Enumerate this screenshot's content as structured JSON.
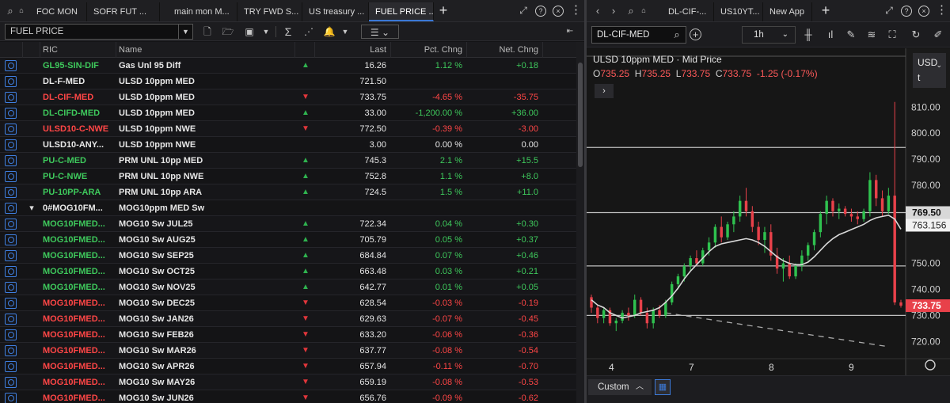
{
  "window_tabs": {
    "left": [
      {
        "label": "FOC MON",
        "active": false
      },
      {
        "label": "SOFR FUT ...",
        "active": false
      },
      {
        "label": "main mon M...",
        "active": false
      },
      {
        "label": "TRY FWD S...",
        "active": false
      },
      {
        "label": "US treasury ...",
        "active": false
      },
      {
        "label": "FUEL PRICE ...",
        "active": true
      }
    ],
    "right": [
      {
        "label": "DL-CIF-...",
        "active": false
      },
      {
        "label": "US10YT...",
        "active": false
      },
      {
        "label": "New App",
        "active": false
      }
    ]
  },
  "quote_list": {
    "search_value": "FUEL PRICE",
    "columns": {
      "ric": "RIC",
      "name": "Name",
      "last": "Last",
      "pct": "Pct. Chng",
      "net": "Net. Chng"
    },
    "rows": [
      {
        "ric": "GL95-SIN-DIF",
        "name": "Gas Unl 95 Diff",
        "dir": "up",
        "last": "16.26",
        "pct": "1.12 %",
        "net": "+0.18",
        "ric_color": "green"
      },
      {
        "ric": "DL-F-MED",
        "name": "ULSD 10ppm MED",
        "dir": "",
        "last": "721.50",
        "pct": "",
        "net": "",
        "ric_color": "white"
      },
      {
        "ric": "DL-CIF-MED",
        "name": "ULSD 10ppm MED",
        "dir": "down",
        "last": "733.75",
        "pct": "-4.65 %",
        "net": "-35.75",
        "ric_color": "red"
      },
      {
        "ric": "DL-CIFD-MED",
        "name": "ULSD 10ppm MED",
        "dir": "up",
        "last": "33.00",
        "pct": "-1,200.00 %",
        "net": "+36.00",
        "ric_color": "green"
      },
      {
        "ric": "ULSD10-C-NWE",
        "name": "ULSD 10ppm NWE",
        "dir": "down",
        "last": "772.50",
        "pct": "-0.39 %",
        "net": "-3.00",
        "ric_color": "red"
      },
      {
        "ric": "ULSD10-ANY...",
        "name": "ULSD 10ppm NWE",
        "dir": "",
        "last": "3.00",
        "pct": "0.00 %",
        "net": "0.00",
        "ric_color": "white"
      },
      {
        "ric": "PU-C-MED",
        "name": "PRM UNL 10pp MED",
        "dir": "up",
        "last": "745.3",
        "pct": "2.1 %",
        "net": "+15.5",
        "ric_color": "green"
      },
      {
        "ric": "PU-C-NWE",
        "name": "PRM UNL 10pp NWE",
        "dir": "up",
        "last": "752.8",
        "pct": "1.1 %",
        "net": "+8.0",
        "ric_color": "green"
      },
      {
        "ric": "PU-10PP-ARA",
        "name": "PRM UNL 10pp ARA",
        "dir": "up",
        "last": "724.5",
        "pct": "1.5 %",
        "net": "+11.0",
        "ric_color": "green"
      },
      {
        "ric": "0#MOG10FM...",
        "name": "MOG10ppm MED Sw",
        "dir": "",
        "last": "",
        "pct": "",
        "net": "",
        "ric_color": "white",
        "chain": true
      },
      {
        "ric": "MOG10FMED...",
        "name": "MOG10 Sw JUL25",
        "dir": "up",
        "last": "722.34",
        "pct": "0.04 %",
        "net": "+0.30",
        "ric_color": "green"
      },
      {
        "ric": "MOG10FMED...",
        "name": "MOG10 Sw AUG25",
        "dir": "up",
        "last": "705.79",
        "pct": "0.05 %",
        "net": "+0.37",
        "ric_color": "green"
      },
      {
        "ric": "MOG10FMED...",
        "name": "MOG10 Sw SEP25",
        "dir": "up",
        "last": "684.84",
        "pct": "0.07 %",
        "net": "+0.46",
        "ric_color": "green"
      },
      {
        "ric": "MOG10FMED...",
        "name": "MOG10 Sw OCT25",
        "dir": "up",
        "last": "663.48",
        "pct": "0.03 %",
        "net": "+0.21",
        "ric_color": "green"
      },
      {
        "ric": "MOG10FMED...",
        "name": "MOG10 Sw NOV25",
        "dir": "up",
        "last": "642.77",
        "pct": "0.01 %",
        "net": "+0.05",
        "ric_color": "green"
      },
      {
        "ric": "MOG10FMED...",
        "name": "MOG10 Sw DEC25",
        "dir": "down",
        "last": "628.54",
        "pct": "-0.03 %",
        "net": "-0.19",
        "ric_color": "red"
      },
      {
        "ric": "MOG10FMED...",
        "name": "MOG10 Sw JAN26",
        "dir": "down",
        "last": "629.63",
        "pct": "-0.07 %",
        "net": "-0.45",
        "ric_color": "red"
      },
      {
        "ric": "MOG10FMED...",
        "name": "MOG10 Sw FEB26",
        "dir": "down",
        "last": "633.20",
        "pct": "-0.06 %",
        "net": "-0.36",
        "ric_color": "red"
      },
      {
        "ric": "MOG10FMED...",
        "name": "MOG10 Sw MAR26",
        "dir": "down",
        "last": "637.77",
        "pct": "-0.08 %",
        "net": "-0.54",
        "ric_color": "red"
      },
      {
        "ric": "MOG10FMED...",
        "name": "MOG10 Sw APR26",
        "dir": "down",
        "last": "657.94",
        "pct": "-0.11 %",
        "net": "-0.70",
        "ric_color": "red"
      },
      {
        "ric": "MOG10FMED...",
        "name": "MOG10 Sw MAY26",
        "dir": "down",
        "last": "659.19",
        "pct": "-0.08 %",
        "net": "-0.53",
        "ric_color": "red"
      },
      {
        "ric": "MOG10FMED...",
        "name": "MOG10 Sw JUN26",
        "dir": "down",
        "last": "656.76",
        "pct": "-0.09 %",
        "net": "-0.62",
        "ric_color": "red"
      }
    ]
  },
  "chart_panel": {
    "symbol_value": "DL-CIF-MED",
    "interval": "1h",
    "currency_line1": "USD",
    "currency_line2": "t",
    "range_label": "Custom",
    "colors": {
      "up": "#2fc24f",
      "down": "#e8414a",
      "ma": "#d8d8d8",
      "price_tag": "#e8414a"
    }
  },
  "chart_data": {
    "type": "candlestick",
    "title": "ULSD 10ppm MED · Mid Price",
    "ohlc_labels": {
      "open": "735.25",
      "high": "735.25",
      "low": "733.75",
      "close": "733.75",
      "change": "-1.25 (-0.17%)"
    },
    "ylim": [
      714,
      818
    ],
    "yticks": [
      "810.00",
      "800.00",
      "790.00",
      "780.00",
      "750.00",
      "740.00",
      "730.00",
      "720.00"
    ],
    "xticks": [
      "4",
      "7",
      "8",
      "9"
    ],
    "horizontal_levels": [
      794.5,
      769.5,
      749,
      730
    ],
    "highlight_level": {
      "value": 769.5,
      "label": "769.50"
    },
    "ma_last_label": "763.156",
    "last_price_label": "733.75",
    "candles": [
      [
        737,
        738,
        731,
        733
      ],
      [
        733,
        734,
        727,
        729
      ],
      [
        729,
        733,
        727,
        732
      ],
      [
        732,
        733,
        726,
        727
      ],
      [
        727,
        729,
        724,
        728
      ],
      [
        728,
        732,
        727,
        731
      ],
      [
        731,
        733,
        728,
        730
      ],
      [
        730,
        738,
        729,
        736
      ],
      [
        736,
        737,
        730,
        731
      ],
      [
        731,
        733,
        725,
        727
      ],
      [
        727,
        733,
        725,
        732
      ],
      [
        732,
        734,
        729,
        730
      ],
      [
        730,
        736,
        729,
        735
      ],
      [
        735,
        743,
        734,
        742
      ],
      [
        742,
        746,
        740,
        745
      ],
      [
        745,
        750,
        743,
        749
      ],
      [
        749,
        753,
        747,
        752
      ],
      [
        752,
        755,
        749,
        750
      ],
      [
        750,
        756,
        749,
        755
      ],
      [
        755,
        760,
        753,
        758
      ],
      [
        758,
        765,
        756,
        764
      ],
      [
        764,
        768,
        758,
        760
      ],
      [
        760,
        766,
        759,
        765
      ],
      [
        765,
        770,
        762,
        768
      ],
      [
        768,
        776,
        766,
        774
      ],
      [
        774,
        779,
        768,
        770
      ],
      [
        770,
        772,
        762,
        764
      ],
      [
        764,
        766,
        757,
        759
      ],
      [
        759,
        764,
        754,
        762
      ],
      [
        762,
        765,
        751,
        753
      ],
      [
        753,
        756,
        746,
        748
      ],
      [
        748,
        752,
        743,
        750
      ],
      [
        750,
        753,
        744,
        745
      ],
      [
        745,
        750,
        744,
        749
      ],
      [
        749,
        755,
        747,
        753
      ],
      [
        753,
        758,
        751,
        757
      ],
      [
        757,
        763,
        755,
        762
      ],
      [
        762,
        770,
        760,
        769
      ],
      [
        769,
        776,
        765,
        774
      ],
      [
        774,
        775,
        768,
        770
      ],
      [
        770,
        773,
        767,
        771
      ],
      [
        771,
        772,
        768,
        769
      ],
      [
        769,
        771,
        766,
        768
      ],
      [
        768,
        770,
        765,
        767
      ],
      [
        767,
        771,
        766,
        770
      ],
      [
        770,
        785,
        768,
        782
      ],
      [
        782,
        784,
        772,
        775
      ],
      [
        775,
        778,
        768,
        770
      ],
      [
        770,
        779,
        769,
        776
      ],
      [
        776,
        812,
        734,
        735
      ],
      [
        735,
        736,
        733,
        733.75
      ]
    ],
    "moving_average": [
      736,
      734,
      733,
      731,
      730,
      729,
      729.5,
      730,
      731,
      731.5,
      732,
      733,
      735,
      737.5,
      740.5,
      744,
      747,
      749.5,
      752,
      754.5,
      756.5,
      757.5,
      758,
      758.5,
      759,
      759.5,
      759,
      758,
      756.5,
      754.5,
      752.5,
      751,
      750,
      749.5,
      749.5,
      750.5,
      752.5,
      755,
      757.5,
      759.5,
      761,
      762,
      763,
      764,
      765,
      766.5,
      767.5,
      768,
      768.5,
      767,
      763.156
    ],
    "trendline": [
      [
        12,
        731
      ],
      [
        48,
        718
      ]
    ]
  }
}
